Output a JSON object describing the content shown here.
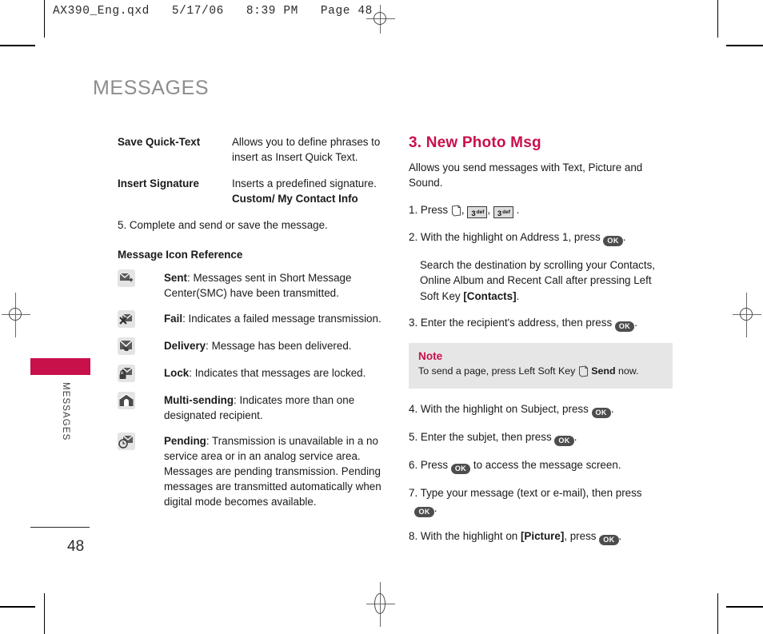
{
  "document": {
    "header_line": "AX390_Eng.qxd   5/17/06   8:39 PM   Page 48",
    "page_title": "MESSAGES",
    "side_tab_label": "MESSAGES",
    "page_number": "48",
    "accent_color": "#c8104b",
    "title_color": "#8d8d8d"
  },
  "left_column": {
    "definitions": [
      {
        "term": "Save Quick-Text",
        "desc": "Allows you to define phrases to insert as Insert Quick Text.",
        "bold_tail": ""
      },
      {
        "term": "Insert Signature",
        "desc": "Inserts a predefined signature.",
        "bold_tail": "Custom/ My Contact Info"
      }
    ],
    "step5": "5. Complete and send or save the message.",
    "icon_reference_heading": "Message Icon Reference",
    "icons": [
      {
        "icon": "envelope-arrow-icon",
        "label": "Sent",
        "desc": ": Messages sent in Short Message Center(SMC) have been transmitted."
      },
      {
        "icon": "envelope-cross-icon",
        "label": "Fail",
        "desc": ": Indicates a failed message transmission."
      },
      {
        "icon": "envelope-hand-icon",
        "label": "Delivery",
        "desc": ": Message has been delivered."
      },
      {
        "icon": "envelope-lock-icon",
        "label": "Lock",
        "desc": ": Indicates that messages are locked."
      },
      {
        "icon": "multi-send-icon",
        "label": "Multi-sending",
        "desc": ": Indicates more than one designated recipient."
      },
      {
        "icon": "envelope-clock-icon",
        "label": "Pending",
        "desc": ": Transmission is unavailable in a no service area or in an analog service area. Messages are pending transmission. Pending messages are transmitted automatically when digital mode becomes available."
      }
    ]
  },
  "right_column": {
    "section_title": "3. New Photo Msg",
    "intro": "Allows you send messages with Text, Picture and Sound.",
    "step1": {
      "prefix": "1. Press",
      "softkey_icon": "left-soft-key-icon",
      "key1": "3",
      "key1_sup": "def",
      "key2": "3",
      "key2_sup": "def",
      "suffix": "."
    },
    "step2": {
      "prefix": "2. With the highlight on Address 1, press",
      "key": "OK",
      "suffix": "."
    },
    "step2_detail": {
      "text": "Search the destination by scrolling your Contacts, Online Album and Recent Call after pressing Left Soft Key ",
      "bold": "[Contacts]",
      "suffix": "."
    },
    "step3": {
      "prefix": "3. Enter the recipient's address, then press",
      "key": "OK",
      "suffix": "."
    },
    "note": {
      "title": "Note",
      "before": "To send a page, press Left Soft Key",
      "icon": "left-soft-key-icon",
      "bold": "Send",
      "after": "now."
    },
    "step4": {
      "prefix": "4. With the highlight on Subject, press",
      "key": "OK",
      "suffix": "."
    },
    "step5": {
      "prefix": "5. Enter the subjet, then press",
      "key": "OK",
      "suffix": "."
    },
    "step6": {
      "prefix": "6. Press",
      "key": "OK",
      "suffix": "to access the message screen."
    },
    "step7": {
      "prefix": "7. Type your message (text or e-mail), then press",
      "key": "OK",
      "suffix": "."
    },
    "step8": {
      "prefix": "8. With the highlight on",
      "bold": "[Picture]",
      "middle": ", press",
      "key": "OK",
      "suffix": "."
    }
  }
}
